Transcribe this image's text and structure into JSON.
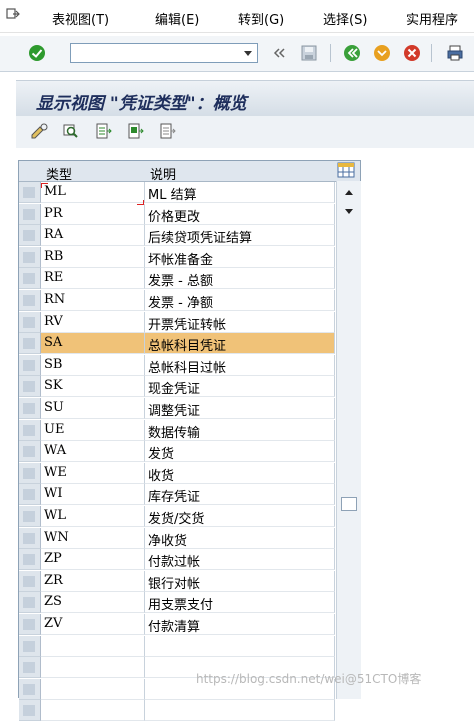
{
  "menubar": {
    "items": [
      "表视图(T)",
      "编辑(E)",
      "转到(G)",
      "选择(S)",
      "实用程序"
    ]
  },
  "toolbar": {
    "command_value": "",
    "icons": [
      "check-icon",
      "back-double-icon",
      "save-icon",
      "back-icon",
      "exit-icon",
      "cancel-icon",
      "print-icon"
    ]
  },
  "screen": {
    "title": "显示视图 \"凭证类型\"：概览"
  },
  "table": {
    "headers": {
      "code": "类型",
      "desc": "说明"
    },
    "rows": [
      {
        "code": "ML",
        "desc": "ML 结算"
      },
      {
        "code": "PR",
        "desc": "价格更改"
      },
      {
        "code": "RA",
        "desc": "后续贷项凭证结算"
      },
      {
        "code": "RB",
        "desc": "坏帐准备金"
      },
      {
        "code": "RE",
        "desc": "发票 - 总额"
      },
      {
        "code": "RN",
        "desc": "发票 - 净额"
      },
      {
        "code": "RV",
        "desc": "开票凭证转帐"
      },
      {
        "code": "SA",
        "desc": "总帐科目凭证",
        "selected": true
      },
      {
        "code": "SB",
        "desc": "总帐科目过帐"
      },
      {
        "code": "SK",
        "desc": "现金凭证"
      },
      {
        "code": "SU",
        "desc": "调整凭证"
      },
      {
        "code": "UE",
        "desc": "数据传输"
      },
      {
        "code": "WA",
        "desc": "发货"
      },
      {
        "code": "WE",
        "desc": "收货"
      },
      {
        "code": "WI",
        "desc": "库存凭证"
      },
      {
        "code": "WL",
        "desc": "发货/交货"
      },
      {
        "code": "WN",
        "desc": "净收货"
      },
      {
        "code": "ZP",
        "desc": "付款过帐"
      },
      {
        "code": "ZR",
        "desc": "银行对帐"
      },
      {
        "code": "ZS",
        "desc": "用支票支付"
      },
      {
        "code": "ZV",
        "desc": "付款清算"
      },
      {
        "code": "",
        "desc": ""
      },
      {
        "code": "",
        "desc": ""
      },
      {
        "code": "",
        "desc": ""
      },
      {
        "code": "",
        "desc": ""
      }
    ],
    "colors": {
      "selected_row": "#f0c278",
      "header_bg": "#dfe6ee"
    }
  },
  "watermark": "https://blog.csdn.net/wei@51CTO博客"
}
